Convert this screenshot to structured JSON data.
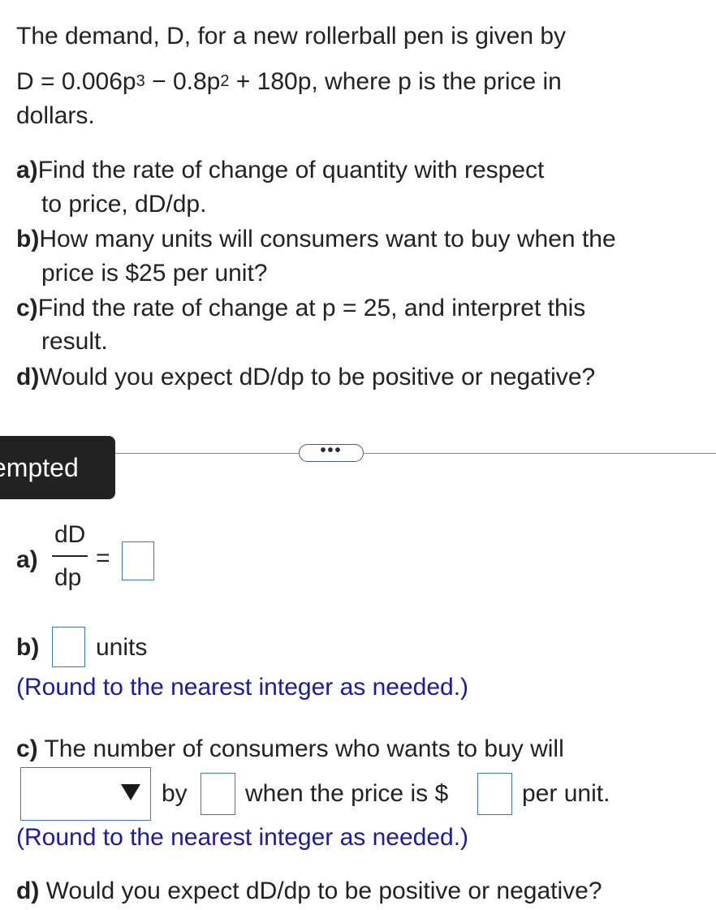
{
  "question": {
    "intro_line1": "The demand, D, for a new rollerball pen is given by",
    "eq_prefix": "D = 0.006p",
    "eq_exp1": "3",
    "eq_mid": " − 0.8p",
    "eq_exp2": "2",
    "eq_suffix": " + 180p, where p is the price in",
    "intro_line3": "dollars.",
    "parts": [
      {
        "label": "a)",
        "line1": "Find the rate of change of quantity with respect",
        "line2": "to price, dD/dp."
      },
      {
        "label": "b)",
        "line1": "How many units will consumers want to buy when the",
        "line2": "price is $25 per unit?"
      },
      {
        "label": "c)",
        "line1": "Find the rate of change at p = 25, and interpret this",
        "line2": "result."
      },
      {
        "label": "d)",
        "line1": "Would you expect dD/dp to be positive or negative?"
      }
    ]
  },
  "divider": {
    "toggle_label": "•••"
  },
  "badge": {
    "label": "empted"
  },
  "answer": {
    "a_label": "a)",
    "a_num": "dD",
    "a_den": "dp",
    "a_eq": "=",
    "b_label": "b)",
    "b_units": "units",
    "b_hint": "(Round to the nearest integer as needed.)",
    "c_label": "c)",
    "c_text": " The number of consumers who wants to buy will",
    "c_by": "by",
    "c_when": "when the price is $",
    "c_per": "per unit.",
    "c_hint": "(Round to the nearest integer as needed.)",
    "d_label": "d)",
    "d_text": " Would you expect dD/dp to be positive or negative?"
  }
}
